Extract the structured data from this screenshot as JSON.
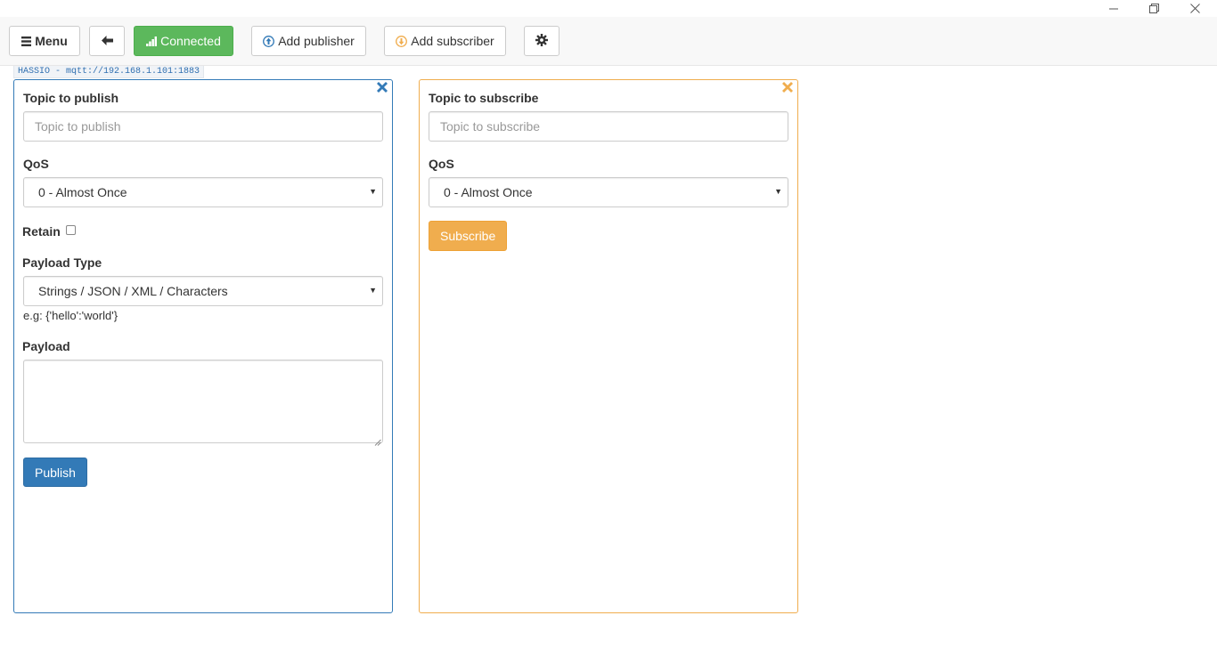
{
  "window": {
    "minimize_icon": "minimize-icon",
    "restore_icon": "restore-icon",
    "close_icon": "close-icon"
  },
  "toolbar": {
    "menu_label": "Menu",
    "back_icon": "arrow-left-icon",
    "connected_label": "Connected",
    "add_publisher_label": "Add publisher",
    "add_subscriber_label": "Add subscriber",
    "settings_icon": "gear-icon"
  },
  "connection": {
    "label": "HASSIO - mqtt://192.168.1.101:1883"
  },
  "publisher": {
    "topic_label": "Topic to publish",
    "topic_placeholder": "Topic to publish",
    "qos_label": "QoS",
    "qos_value": "0 - Almost Once",
    "retain_label": "Retain",
    "retain_checked": false,
    "payload_type_label": "Payload Type",
    "payload_type_value": "Strings / JSON / XML / Characters",
    "payload_hint": "e.g: {'hello':'world'}",
    "payload_label": "Payload",
    "payload_value": "",
    "publish_button": "Publish"
  },
  "subscriber": {
    "topic_label": "Topic to subscribe",
    "topic_placeholder": "Topic to subscribe",
    "qos_label": "QoS",
    "qos_value": "0 - Almost Once",
    "subscribe_button": "Subscribe"
  },
  "colors": {
    "publisher_accent": "#337ab7",
    "subscriber_accent": "#f0ad4e",
    "connected": "#5cb85c"
  }
}
